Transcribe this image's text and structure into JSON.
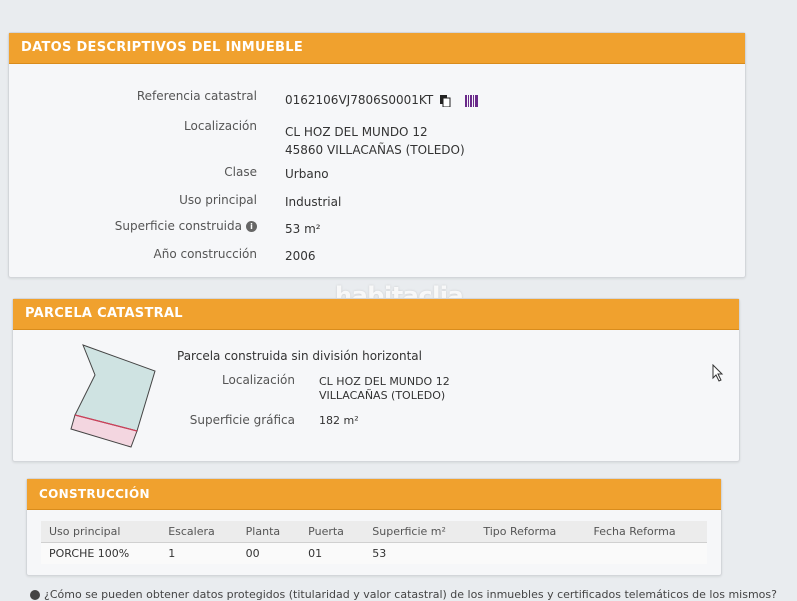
{
  "datos": {
    "header": "DATOS DESCRIPTIVOS DEL INMUEBLE",
    "fields": [
      {
        "label": "Referencia catastral",
        "value": "0162106VJ7806S0001KT"
      },
      {
        "label": "Localización",
        "value": "CL HOZ DEL MUNDO 12",
        "value2": "45860 VILLACAÑAS (TOLEDO)"
      },
      {
        "label": "Clase",
        "value": "Urbano"
      },
      {
        "label": "Uso principal",
        "value": "Industrial"
      },
      {
        "label": "Superficie construida",
        "value": "53 m²"
      },
      {
        "label": "Año construcción",
        "value": "2006"
      }
    ],
    "info_icon": "i"
  },
  "parcela": {
    "header": "PARCELA CATASTRAL",
    "subtitle": "Parcela construida sin división horizontal",
    "loc_label": "Localización",
    "loc_value1": "CL HOZ DEL MUNDO 12",
    "loc_value2": "VILLACAÑAS (TOLEDO)",
    "sup_label": "Superficie gráfica",
    "sup_value": "182 m²"
  },
  "construccion": {
    "header": "CONSTRUCCIÓN",
    "columns": [
      "Uso principal",
      "Escalera",
      "Planta",
      "Puerta",
      "Superficie m²",
      "Tipo Reforma",
      "Fecha Reforma"
    ],
    "rows": [
      [
        "PORCHE 100%",
        "1",
        "00",
        "01",
        "53",
        "",
        ""
      ]
    ]
  },
  "watermark": "habitaclia",
  "footer": "¿Cómo se pueden obtener datos protegidos (titularidad y valor catastral) de los inmuebles y certificados telemáticos de los mismos?"
}
